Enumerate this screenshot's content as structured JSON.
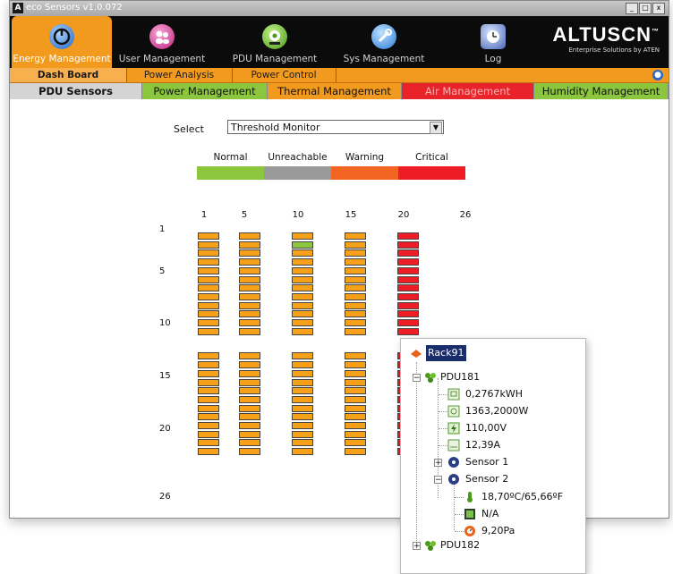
{
  "window": {
    "title": "eco Sensors v1.0.072",
    "app_icon": "A",
    "controls": [
      "_",
      "□",
      "x"
    ]
  },
  "header": {
    "nav": [
      {
        "label": "Energy Management",
        "icon": "power-icon",
        "active": true
      },
      {
        "label": "User Management",
        "icon": "users-icon",
        "active": false
      },
      {
        "label": "PDU Management",
        "icon": "pdu-icon",
        "active": false
      },
      {
        "label": "Sys Management",
        "icon": "system-icon",
        "active": false
      },
      {
        "label": "Log",
        "icon": "log-icon",
        "active": false
      }
    ],
    "logo": {
      "main": "ALTUSCN",
      "tm": "™",
      "sub": "Enterprise Solutions by ATEN"
    }
  },
  "subnav": {
    "items": [
      {
        "label": "Dash Board",
        "active": true
      },
      {
        "label": "Power Analysis",
        "active": false
      },
      {
        "label": "Power Control",
        "active": false
      }
    ]
  },
  "tabs": [
    {
      "label": "PDU Sensors",
      "bg": "#d4d4d4",
      "fg": "#111111",
      "bold": true
    },
    {
      "label": "Power Management",
      "bg": "#8cc63f",
      "fg": "#111111"
    },
    {
      "label": "Thermal Management",
      "bg": "#f29a1e",
      "fg": "#111111"
    },
    {
      "label": "Air Management",
      "bg": "#e8242a",
      "fg": "#f5b3b3"
    },
    {
      "label": "Humidity Management",
      "bg": "#8cc63f",
      "fg": "#111111"
    }
  ],
  "select": {
    "label": "Select",
    "value": "Threshold Monitor"
  },
  "legend": [
    {
      "label": "Normal",
      "color": "#8cc63f"
    },
    {
      "label": "Unreachable",
      "color": "#9a9a9a"
    },
    {
      "label": "Warning",
      "color": "#f26522"
    },
    {
      "label": "Critical",
      "color": "#ee1c24"
    }
  ],
  "grid": {
    "column_labels": [
      "1",
      "5",
      "10",
      "15",
      "20",
      "26"
    ],
    "row_labels": [
      "1",
      "5",
      "10",
      "15",
      "20",
      "26"
    ],
    "colors": {
      "warning": "#f7a11a",
      "normal": "#8cc63f",
      "critical": "#ee1c24"
    },
    "columns": [
      {
        "id": "1",
        "normal_slots": [],
        "critical": false
      },
      {
        "id": "5",
        "normal_slots": [],
        "critical": false
      },
      {
        "id": "10",
        "normal_slots": [
          2
        ],
        "critical": false
      },
      {
        "id": "15",
        "normal_slots": [],
        "critical": false
      },
      {
        "id": "20",
        "normal_slots": [],
        "critical": true
      }
    ]
  },
  "tree": {
    "rack": "Rack91",
    "pdu": "PDU181",
    "readings": [
      {
        "value": "0,2767kWH",
        "icon": "energy-icon"
      },
      {
        "value": "1363,2000W",
        "icon": "power-meter-icon"
      },
      {
        "value": "110,00V",
        "icon": "voltage-icon"
      },
      {
        "value": "12,39A",
        "icon": "current-icon"
      }
    ],
    "sensor1": "Sensor 1",
    "sensor2": "Sensor 2",
    "sensor2_readings": [
      {
        "value": "18,70ºC/65,66ºF",
        "icon": "temperature-icon"
      },
      {
        "value": "N/A",
        "icon": "humidity-icon"
      },
      {
        "value": "9,20Pa",
        "icon": "pressure-icon"
      }
    ],
    "pdu2": "PDU182"
  }
}
